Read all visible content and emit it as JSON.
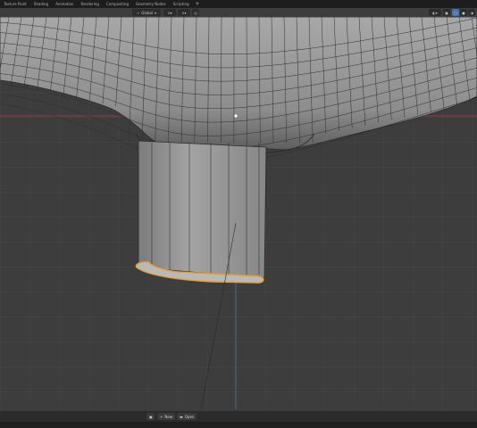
{
  "topbar": {
    "tabs": [
      "Texture Paint",
      "Shading",
      "Animation",
      "Rendering",
      "Compositing",
      "Geometry Nodes",
      "Scripting"
    ],
    "add_tab": "+"
  },
  "header": {
    "transform_orientation": "Global"
  },
  "statusbar": {
    "new_label": "New",
    "open_label": "Open"
  },
  "colors": {
    "background": "#3d3d3d",
    "grid": "#4a4a4a",
    "mesh_fill": "#9a9a9a",
    "wire": "#2a2a2a",
    "selection": "#e8a033",
    "x_axis": "#8a3b48",
    "z_axis": "#4a7a9a"
  },
  "icons": [
    "chevron-down-icon",
    "global-axes-icon",
    "magnet-icon",
    "proportional-edit-icon",
    "overlay-icon",
    "xray-icon",
    "shading-wireframe-icon",
    "shading-solid-icon",
    "folder-icon",
    "new-file-icon"
  ]
}
